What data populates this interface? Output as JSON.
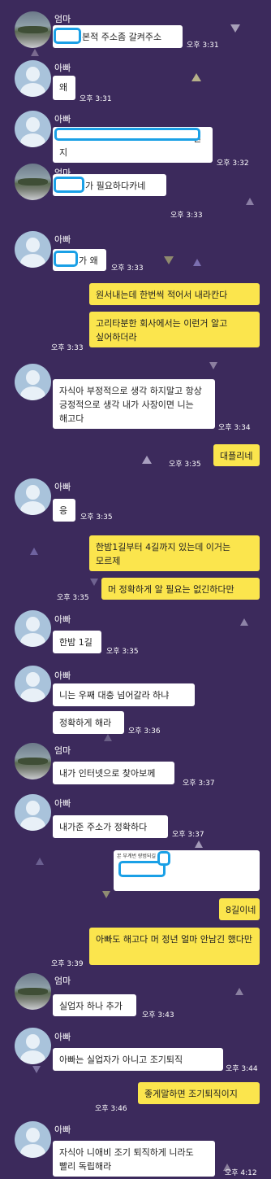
{
  "senders": {
    "mom": "엄마",
    "dad": "아빠"
  },
  "colors": {
    "background": "#3c2a5c",
    "my_bubble": "#fbe54d",
    "other_bubble": "#ffffff",
    "redaction": "#1aa0e6"
  },
  "messages": [
    {
      "id": 1,
      "side": "left",
      "sender": "엄마",
      "text": "본적 주소좀 갈켜주소",
      "time": "오후 3:31"
    },
    {
      "id": 2,
      "side": "left",
      "sender": "아빠",
      "text": "왜",
      "time": "오후 3:31"
    },
    {
      "id": 3,
      "side": "left",
      "sender": "아빠",
      "text_suffix": "번",
      "text_line2": "지",
      "time": "오후 3:32"
    },
    {
      "id": 4,
      "side": "left",
      "sender": "엄마",
      "text": "가 필요하다카네",
      "time": "오후 3:33"
    },
    {
      "id": 5,
      "side": "left",
      "sender": "아빠",
      "text": "가 왜",
      "time": "오후 3:33"
    },
    {
      "id": 6,
      "side": "right",
      "text": "원서내는데 한번씩 적어서 내라칸다"
    },
    {
      "id": 7,
      "side": "right",
      "text": "고리타분한 회사에서는 이런거 알고 싶어하더라",
      "time": "오후 3:33"
    },
    {
      "id": 8,
      "side": "left",
      "text": "자식아 부정적으로 생각 하지말고 항상 긍정적으로 생각 내가 사장이면 니는 해고다",
      "time": "오후 3:34"
    },
    {
      "id": 9,
      "side": "right",
      "text": "대플리네",
      "time": "오후 3:35"
    },
    {
      "id": 10,
      "side": "left",
      "sender": "아빠",
      "text": "응",
      "time": "오후 3:35"
    },
    {
      "id": 11,
      "side": "right",
      "text": "한밤1길부터 4길까지 있는데 이거는 모르제"
    },
    {
      "id": 12,
      "side": "right",
      "text": "머 정확하게 알 필요는 없긴하다만",
      "time": "오후 3:35"
    },
    {
      "id": 13,
      "side": "left",
      "sender": "아빠",
      "text": "한밤 1길",
      "time": "오후 3:35"
    },
    {
      "id": 14,
      "side": "left",
      "sender": "아빠",
      "text": "니는 우째 대충 넘어갈라 하냐"
    },
    {
      "id": 15,
      "side": "left",
      "text": "정확하게 해라",
      "time": "오후 3:36"
    },
    {
      "id": 16,
      "side": "left",
      "sender": "엄마",
      "text": "내가 인터넷으로 찾아보께",
      "time": "오후 3:37"
    },
    {
      "id": 17,
      "side": "left",
      "sender": "아빠",
      "text": "내가준 주소가 정확하다",
      "time": "오후 3:37"
    },
    {
      "id": 18,
      "side": "right",
      "image_caption": "본 부계번 량범되길"
    },
    {
      "id": 19,
      "side": "right",
      "text": "8길이네"
    },
    {
      "id": 20,
      "side": "right",
      "text": "아빠도 해고다 머 정년 얼마 안남긴 했다만",
      "time": "오후 3:39"
    },
    {
      "id": 21,
      "side": "left",
      "sender": "엄마",
      "text": "실업자 하나 추가",
      "time": "오후 3:43"
    },
    {
      "id": 22,
      "side": "left",
      "sender": "아빠",
      "text": "아빠는 실업자가 아니고 조기퇴직",
      "time": "오후 3:44"
    },
    {
      "id": 23,
      "side": "right",
      "text": "좋게말하면 조기퇴직이지",
      "time": "오후 3:46"
    },
    {
      "id": 24,
      "side": "left",
      "sender": "아빠",
      "text": "자식아 니애비 조기 퇴직하게 니라도 빨리 독립해라",
      "time": "오후 4:12"
    }
  ]
}
